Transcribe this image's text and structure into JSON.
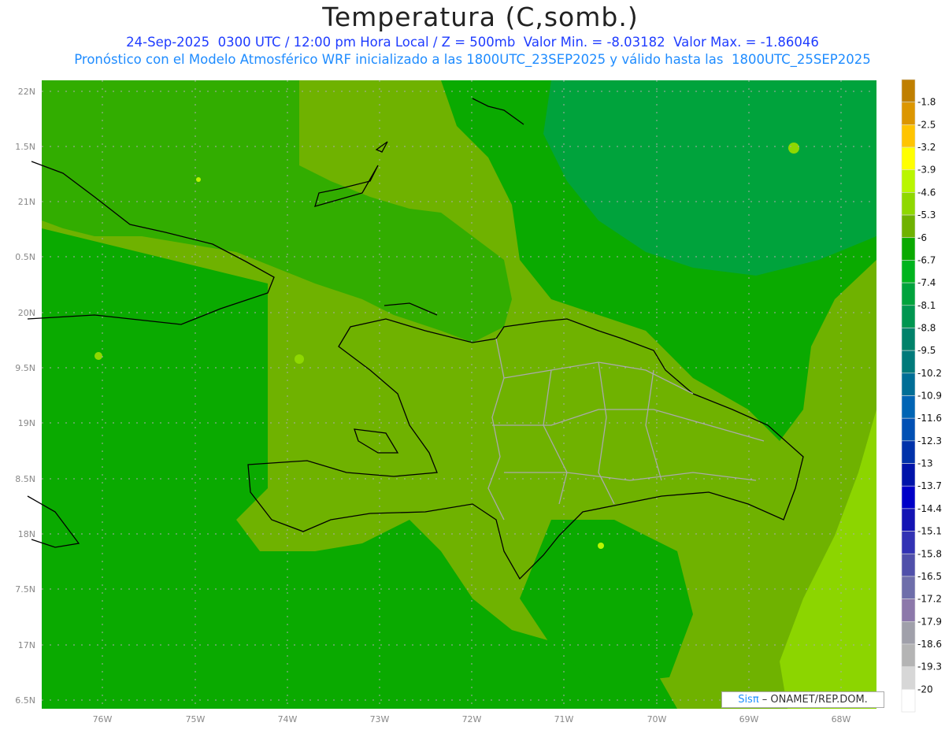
{
  "title": "Temperatura (C,somb.)",
  "subtitle": "24-Sep-2025  0300 UTC / 12:00 pm Hora Local / Z = 500mb  Valor Min. = -8.03182  Valor Max. = -1.86046",
  "subtitle2": "Pronóstico con el Modelo Atmosférico WRF inicializado a las 1800UTC_23SEP2025 y válido hasta las  1800UTC_25SEP2025",
  "lat_labels": [
    "22N",
    "1.5N",
    "21N",
    "0.5N",
    "20N",
    "9.5N",
    "19N",
    "8.5N",
    "18N",
    "7.5N",
    "17N",
    "6.5N"
  ],
  "lon_labels": [
    "76W",
    "75W",
    "74W",
    "73W",
    "72W",
    "71W",
    "70W",
    "69W",
    "68W"
  ],
  "colorbar": {
    "labels": [
      "-1.8",
      "-2.5",
      "-3.2",
      "-3.9",
      "-4.6",
      "-5.3",
      "-6",
      "-6.7",
      "-7.4",
      "-8.1",
      "-8.8",
      "-9.5",
      "-10.2",
      "-10.9",
      "-11.6",
      "-12.3",
      "-13",
      "-13.7",
      "-14.4",
      "-15.1",
      "-15.8",
      "-16.5",
      "-17.2",
      "-17.9",
      "-18.6",
      "-19.3",
      "-20"
    ],
    "colors": [
      "#bf7f00",
      "#dc9600",
      "#ffc400",
      "#ffff00",
      "#b9f600",
      "#8fd800",
      "#6fb200",
      "#0aaa00",
      "#00b41e",
      "#00a33c",
      "#009650",
      "#00826a",
      "#007a7a",
      "#006e96",
      "#0064b4",
      "#0050b4",
      "#0032aa",
      "#0014aa",
      "#0000c8",
      "#1414b4",
      "#3232b4",
      "#5050aa",
      "#6e6eaa",
      "#8c78aa",
      "#a0a0aa",
      "#b4b4b4",
      "#d7d7d7",
      "#ffffff"
    ]
  },
  "credit": {
    "brand": "Sisπ",
    "text": " – ONAMET/REP.DOM."
  }
}
